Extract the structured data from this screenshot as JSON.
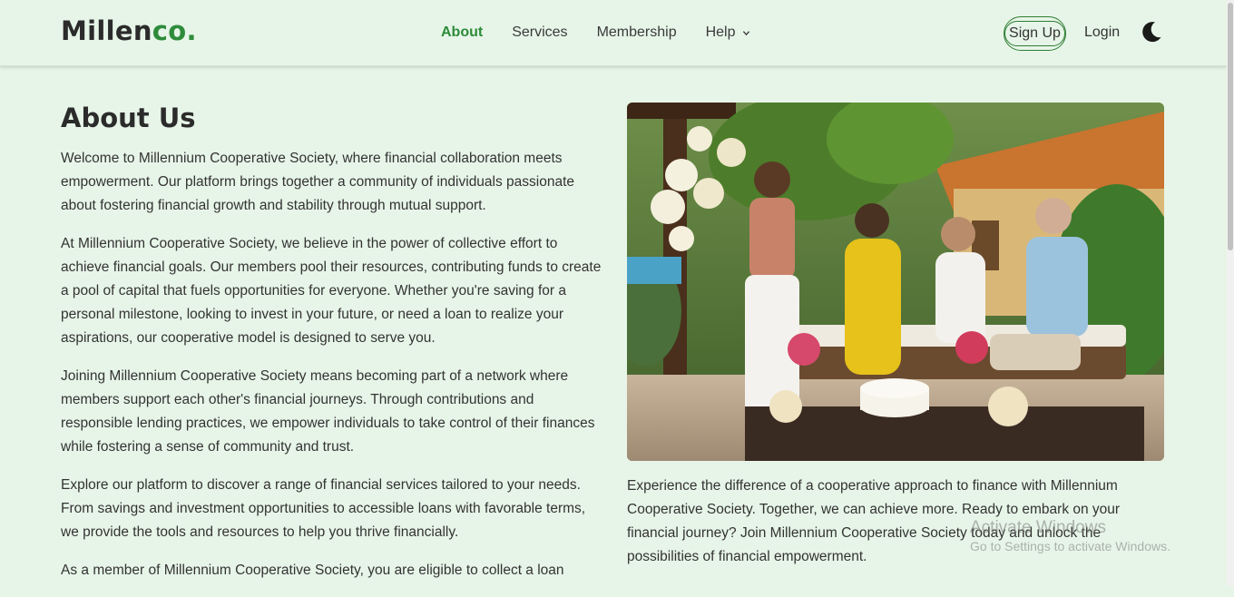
{
  "brand": {
    "name_main": "Millen",
    "name_accent": "co."
  },
  "nav": {
    "about": "About",
    "services": "Services",
    "membership": "Membership",
    "help": "Help",
    "signup": "Sign Up",
    "login": "Login"
  },
  "about": {
    "title": "About Us",
    "paragraphs": [
      "Welcome to Millennium Cooperative Society, where financial collaboration meets empowerment. Our platform brings together a community of individuals passionate about fostering financial growth and stability through mutual support.",
      "At Millennium Cooperative Society, we believe in the power of collective effort to achieve financial goals. Our members pool their resources, contributing funds to create a pool of capital that fuels opportunities for everyone. Whether you're saving for a personal milestone, looking to invest in your future, or need a loan to realize your aspirations, our cooperative model is designed to serve you.",
      "Joining Millennium Cooperative Society means becoming part of a network where members support each other's financial journeys. Through contributions and responsible lending practices, we empower individuals to take control of their finances while fostering a sense of community and trust.",
      "Explore our platform to discover a range of financial services tailored to your needs. From savings and investment opportunities to accessible loans with favorable terms, we provide the tools and resources to help you thrive financially.",
      "As a member of Millennium Cooperative Society, you are eligible to collect a loan"
    ],
    "right_paragraph": "Experience the difference of a cooperative approach to finance with Millennium Cooperative Society. Together, we can achieve more. Ready to embark on your financial journey? Join Millennium Cooperative Society today and unlock the possibilities of financial empowerment."
  },
  "watermark": {
    "title": "Activate Windows",
    "subtitle": "Go to Settings to activate Windows."
  },
  "icons": {
    "theme_toggle": "moon-icon",
    "help_dropdown": "chevron-down-icon"
  },
  "colors": {
    "accent": "#2e8b3a",
    "background": "#e7f5e8",
    "text": "#333333"
  }
}
